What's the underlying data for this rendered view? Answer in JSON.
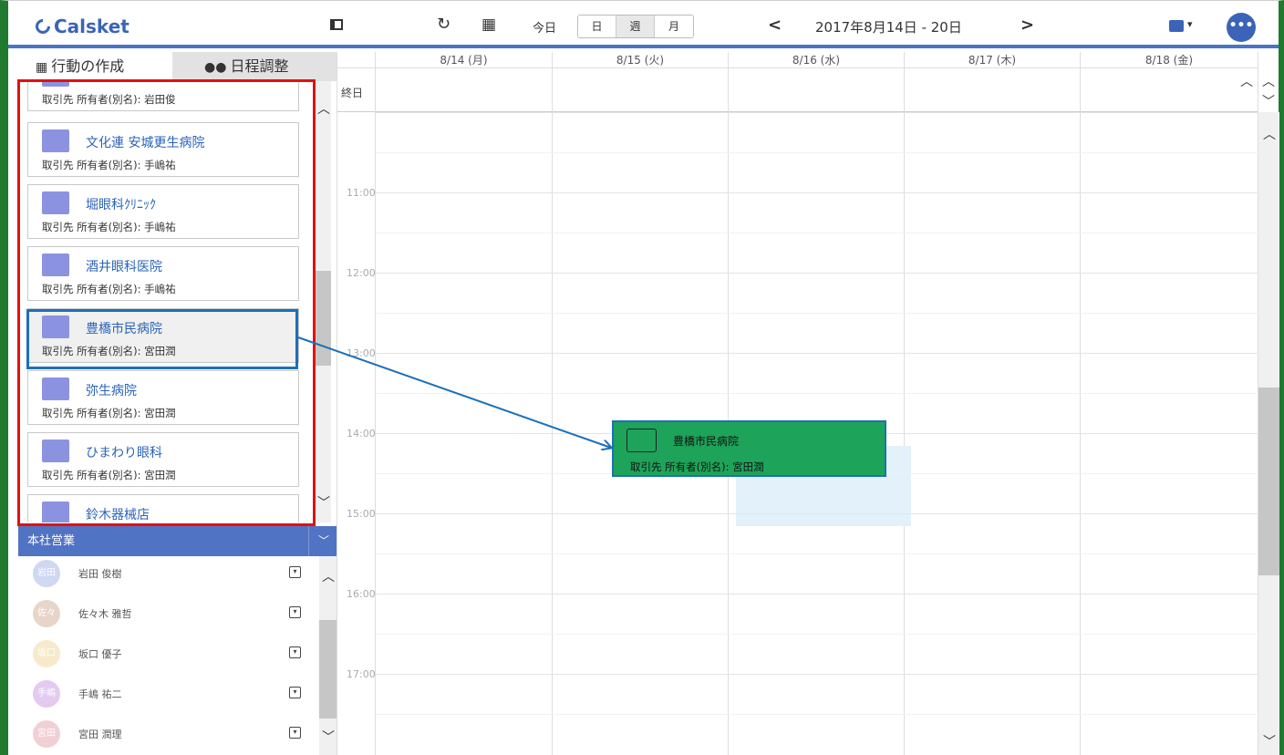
{
  "app": {
    "logo": "Calsket"
  },
  "toolbar": {
    "today_label": "今日",
    "views": [
      "日",
      "週",
      "月"
    ],
    "active_view": "週",
    "range": "2017年8月14日 - 20日",
    "prev": "<",
    "next": ">",
    "more": "•••"
  },
  "left_tabs": [
    {
      "label": "行動の作成",
      "icon": "calendar-add-icon"
    },
    {
      "label": "日程調整",
      "icon": "group-icon"
    }
  ],
  "accounts": [
    {
      "name": "",
      "sub": "取引先 所有者(別名): 岩田俊"
    },
    {
      "name": "文化連 安城更生病院",
      "sub": "取引先 所有者(別名): 手嶋祐"
    },
    {
      "name": "堀眼科ｸﾘﾆｯｸ",
      "sub": "取引先 所有者(別名): 手嶋祐"
    },
    {
      "name": "酒井眼科医院",
      "sub": "取引先 所有者(別名): 手嶋祐"
    },
    {
      "name": "豊橋市民病院",
      "sub": "取引先 所有者(別名): 宮田潤"
    },
    {
      "name": "弥生病院",
      "sub": "取引先 所有者(別名): 宮田潤"
    },
    {
      "name": "ひまわり眼科",
      "sub": "取引先 所有者(別名): 宮田潤"
    },
    {
      "name": "鈴木器械店",
      "sub": ""
    }
  ],
  "group": {
    "label": "本社営業"
  },
  "members": [
    {
      "initials": "岩田",
      "name": "岩田 俊樹",
      "color": "#7a8fd8"
    },
    {
      "initials": "佐々",
      "name": "佐々木 雅哲",
      "color": "#c08a6a"
    },
    {
      "initials": "坂口",
      "name": "坂口 優子",
      "color": "#e8c66a"
    },
    {
      "initials": "手嶋",
      "name": "手嶋 祐二",
      "color": "#b06ad8"
    },
    {
      "initials": "宮田",
      "name": "宮田 潤理",
      "color": "#d87a8a"
    }
  ],
  "calendar": {
    "allday_label": "終日",
    "days": [
      "8/14 (月)",
      "8/15 (火)",
      "8/16 (水)",
      "8/17 (木)",
      "8/18 (金)"
    ],
    "times": [
      "11:00",
      "12:00",
      "13:00",
      "14:00",
      "15:00",
      "16:00",
      "17:00"
    ]
  },
  "event": {
    "name": "豊橋市民病院",
    "sub": "取引先 所有者(別名): 宮田潤",
    "color": "#1ea35a"
  }
}
